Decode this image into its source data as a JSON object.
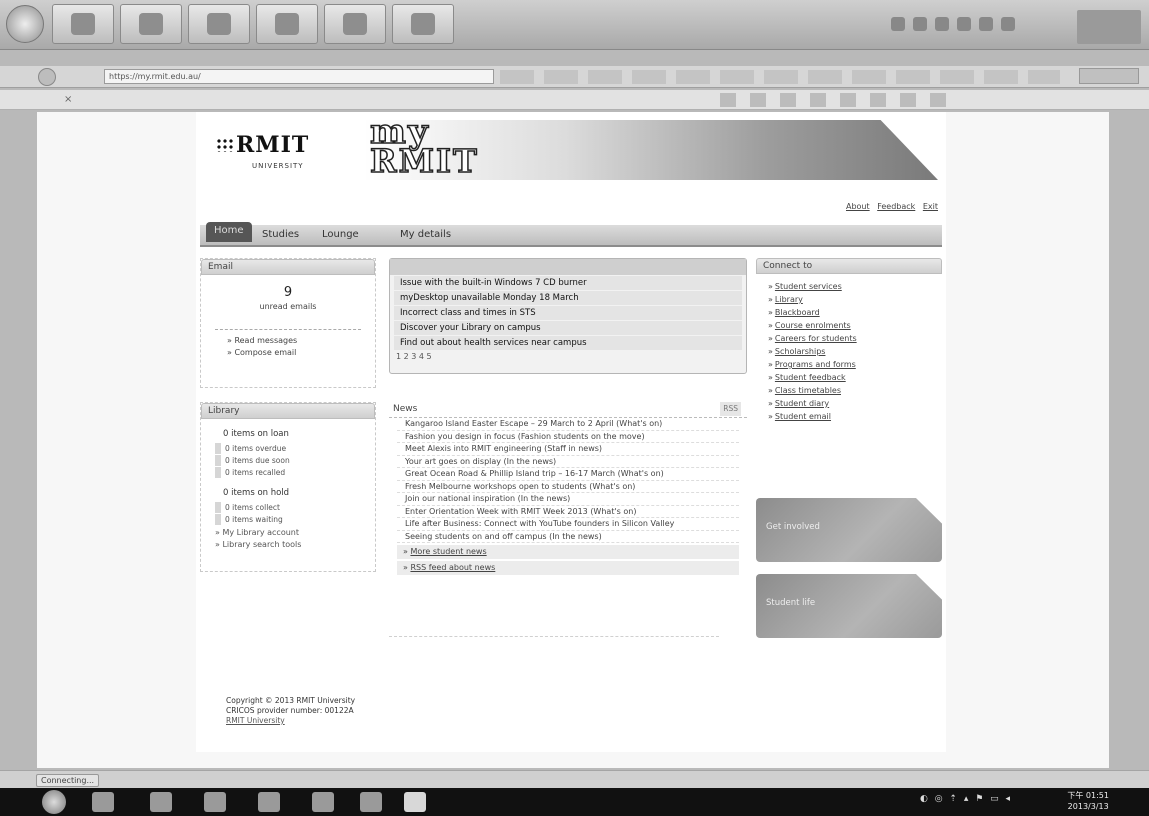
{
  "browser": {
    "url": "https://my.rmit.edu.au/",
    "tab_label": "",
    "status": "Connecting..."
  },
  "header": {
    "logo_text": "RMIT",
    "logo_sub": "UNIVERSITY",
    "banner_line1": "my",
    "banner_line2": "RMIT",
    "links": [
      "About",
      "Feedback",
      "Exit"
    ]
  },
  "menu": [
    "Home",
    "Studies",
    "Lounge",
    "My details"
  ],
  "email": {
    "title": "Email",
    "count": "9",
    "sublabel": "unread emails",
    "links": [
      "Read messages",
      "Compose email"
    ]
  },
  "library": {
    "title": "Library",
    "group1_heading": "0 items on loan",
    "group1_items": [
      "0 items overdue",
      "0 items due soon",
      "0 items recalled"
    ],
    "group2_heading": "0 items on hold",
    "group2_items": [
      "0 items collect",
      "0 items waiting"
    ],
    "links": [
      "My Library account",
      "Library search tools"
    ]
  },
  "announcements": {
    "rows": [
      "Issue with the built-in Windows 7 CD burner",
      "myDesktop unavailable Monday 18 March",
      "Incorrect class and times in STS",
      "Discover your Library on campus",
      "Find out about health services near campus"
    ],
    "pager": "1 2 3 4 5"
  },
  "news": {
    "title": "News",
    "rss": "RSS",
    "items": [
      "Kangaroo Island Easter Escape – 29 March to 2 April (What's on)",
      "Fashion you design in focus (Fashion students on the move)",
      "Meet Alexis into RMIT engineering (Staff in news)",
      "Your art goes on display (In the news)",
      "Great Ocean Road & Phillip Island trip – 16-17 March (What's on)",
      "Fresh Melbourne workshops open to students (What's on)",
      "Join our national inspiration (In the news)",
      "Enter Orientation Week with RMIT Week 2013 (What's on)",
      "Life after Business: Connect with YouTube founders in Silicon Valley",
      "Seeing students on and off campus (In the news)"
    ],
    "more1": "More student news",
    "more2": "RSS feed about news"
  },
  "connect": {
    "title": "Connect to",
    "links": [
      "Student services",
      "Library",
      "Blackboard",
      "Course enrolments",
      "Careers for students",
      "Scholarships",
      "Programs and forms",
      "Student feedback",
      "Class timetables",
      "Student diary",
      "Student email"
    ]
  },
  "promos": [
    "Get involved",
    "Student life"
  ],
  "footer": {
    "line1": "Copyright © 2013 RMIT University",
    "line2": "CRICOS provider number: 00122A",
    "line3": "RMIT University"
  },
  "taskbar": {
    "time": "下午 01:51",
    "date": "2013/3/13"
  }
}
